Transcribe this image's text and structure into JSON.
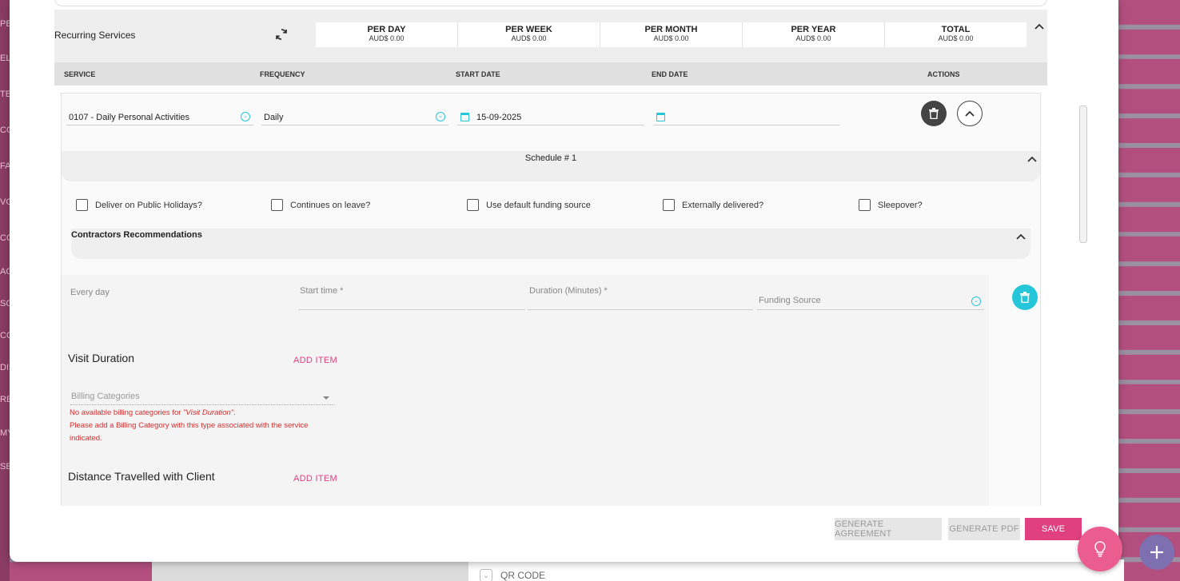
{
  "background": {
    "left_strip_letters": [
      "PE",
      "EL",
      "TE",
      "CO",
      "FA",
      "VO",
      "CO",
      "AC",
      "SC",
      "CO",
      "DIS",
      "RE",
      "MY",
      "SE"
    ],
    "qr_label": "QR CODE"
  },
  "summary": {
    "title": "Recurring Services",
    "totals": [
      {
        "label": "PER DAY",
        "value": "AUD$ 0.00"
      },
      {
        "label": "PER WEEK",
        "value": "AUD$ 0.00"
      },
      {
        "label": "PER MONTH",
        "value": "AUD$ 0.00"
      },
      {
        "label": "PER YEAR",
        "value": "AUD$ 0.00"
      },
      {
        "label": "TOTAL",
        "value": "AUD$ 0.00"
      }
    ]
  },
  "columns": {
    "service": "SERVICE",
    "frequency": "FREQUENCY",
    "start_date": "START DATE",
    "end_date": "END DATE",
    "actions": "ACTIONS"
  },
  "service_row": {
    "service": "0107 - Daily Personal Activities",
    "frequency": "Daily",
    "start_date": "15-09-2025",
    "end_date": ""
  },
  "schedule": {
    "title": "Schedule # 1",
    "checkboxes": [
      {
        "label": "Deliver on Public Holidays?",
        "checked": false
      },
      {
        "label": "Continues on leave?",
        "checked": false
      },
      {
        "label": "Use default funding source",
        "checked": false
      },
      {
        "label": "Externally delivered?",
        "checked": false
      },
      {
        "label": "Sleepover?",
        "checked": false
      }
    ],
    "contractors_title": "Contractors Recommendations",
    "every_day": "Every day",
    "start_time_placeholder": "Start time *",
    "duration_placeholder": "Duration (Minutes) *",
    "funding_placeholder": "Funding Source"
  },
  "visit_duration": {
    "title": "Visit Duration",
    "add_item": "ADD ITEM",
    "billing_placeholder": "Billing Categories",
    "error_prefix": "No available billing categories for ",
    "error_category": "\"Visit Duration\"",
    "error_suffix": ".",
    "error_line2": "Please add a Billing Category with this type associated with the service",
    "error_line3": "indicated."
  },
  "distance": {
    "title": "Distance Travelled with Client",
    "add_item": "ADD ITEM"
  },
  "footer": {
    "generate_agreement": "GENERATE AGREEMENT",
    "generate_pdf": "GENERATE PDF",
    "save": "SAVE"
  },
  "colors": {
    "accent_pink": "#e0407f",
    "teal": "#26c6da",
    "fab_purple": "#7e6fb0",
    "background_magenta": "#b24f7f"
  }
}
